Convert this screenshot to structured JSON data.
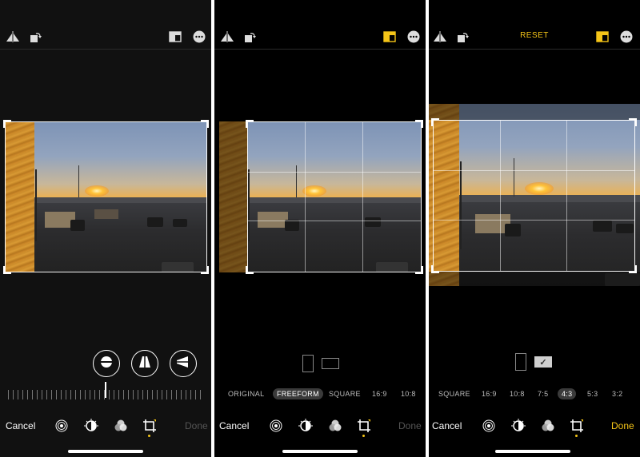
{
  "colors": {
    "accent": "#f5c518",
    "background": "#000000",
    "text": "#ffffff",
    "dim_text": "#555555"
  },
  "panels": [
    {
      "topbar": {
        "icons": [
          "flip-horizontal-icon",
          "rotate-icon",
          "aspect-ratio-icon",
          "more-icon"
        ]
      },
      "perspective_buttons": [
        "straighten-icon",
        "vertical-perspective-icon",
        "horizontal-perspective-icon"
      ],
      "toolbar": {
        "cancel": "Cancel",
        "done": "Done",
        "tools": [
          "live-icon",
          "adjust-icon",
          "filters-icon",
          "crop-icon"
        ]
      }
    },
    {
      "topbar": {
        "icons": [
          "flip-horizontal-icon",
          "rotate-icon",
          "aspect-ratio-icon",
          "more-icon"
        ]
      },
      "aspect_options": [
        "ORIGINAL",
        "FREEFORM",
        "SQUARE",
        "16:9",
        "10:8"
      ],
      "selected_aspect": "FREEFORM",
      "toolbar": {
        "cancel": "Cancel",
        "done": "Done",
        "tools": [
          "live-icon",
          "adjust-icon",
          "filters-icon",
          "crop-icon"
        ]
      }
    },
    {
      "topbar": {
        "reset": "RESET",
        "icons": [
          "flip-horizontal-icon",
          "rotate-icon",
          "aspect-ratio-icon",
          "more-icon"
        ]
      },
      "orientation_check": "✓",
      "aspect_options": [
        "SQUARE",
        "16:9",
        "10:8",
        "7:5",
        "4:3",
        "5:3",
        "3:2"
      ],
      "selected_aspect": "4:3",
      "toolbar": {
        "cancel": "Cancel",
        "done": "Done",
        "tools": [
          "live-icon",
          "adjust-icon",
          "filters-icon",
          "crop-icon"
        ]
      }
    }
  ]
}
